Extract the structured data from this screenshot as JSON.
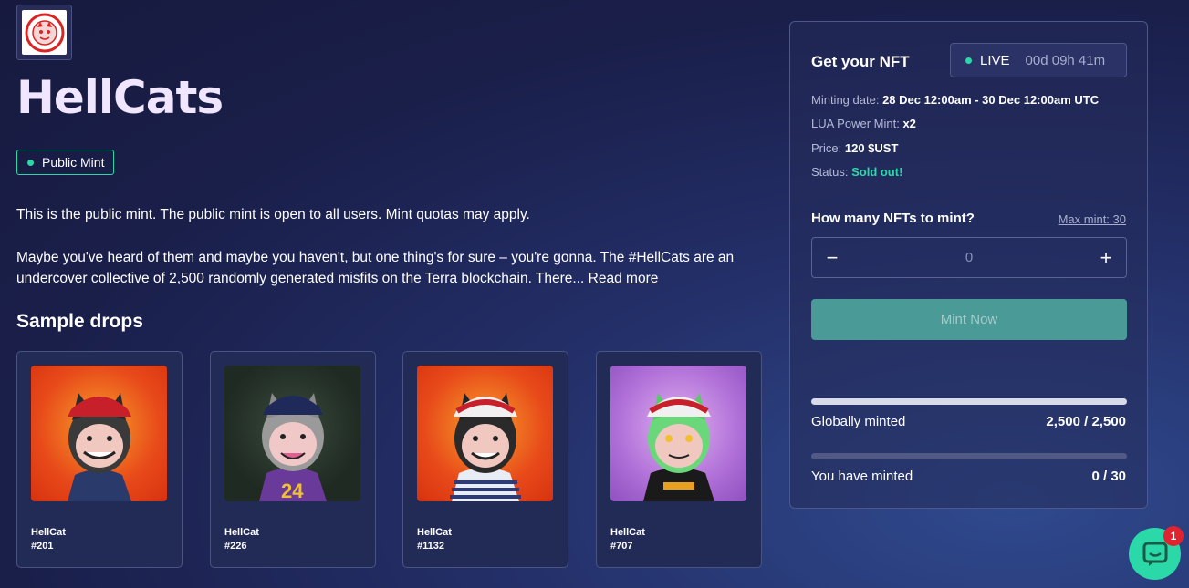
{
  "collection": {
    "logo_text_top": "HELL CATS",
    "logo_text_bottom": "HELL CATS",
    "title": "HellCats",
    "badge": "Public Mint",
    "description_1": "This is the public mint. The public mint is open to all users. Mint quotas may apply.",
    "description_2": "Maybe you've heard of them and maybe you haven't, but one thing's for sure – you're gonna. The #HellCats are an undercover collective of 2,500 randomly generated misfits on the Terra blockchain. There...",
    "read_more": "Read more"
  },
  "sample_drops": {
    "heading": "Sample drops",
    "items": [
      {
        "name": "HellCat",
        "id": "#201",
        "bg": "#e8401a"
      },
      {
        "name": "HellCat",
        "id": "#226",
        "bg": "#233025"
      },
      {
        "name": "HellCat",
        "id": "#1132",
        "bg": "#e84a1c"
      },
      {
        "name": "HellCat",
        "id": "#707",
        "bg": "#b87ad8"
      }
    ]
  },
  "mint_panel": {
    "title": "Get your NFT",
    "live_label": "LIVE",
    "countdown": "00d 09h 41m",
    "minting_date_label": "Minting date:",
    "minting_date": "28 Dec 12:00am - 30 Dec 12:00am UTC",
    "power_mint_label": "LUA Power Mint:",
    "power_mint": "x2",
    "price_label": "Price:",
    "price": "120 $UST",
    "status_label": "Status:",
    "status": "Sold out!",
    "quantity_label": "How many NFTs to mint?",
    "max_mint": "Max mint: 30",
    "minus": "−",
    "plus": "+",
    "quantity_value": "0",
    "mint_button": "Mint Now",
    "global_label": "Globally minted",
    "global_value": "2,500 / 2,500",
    "global_fraction": 1.0,
    "user_label": "You have minted",
    "user_value": "0 / 30",
    "user_fraction": 0.0
  },
  "chat": {
    "notification_count": "1"
  },
  "colors": {
    "accent": "#2bd9a8",
    "mint_button": "#4a9a98",
    "notification": "#e0232f"
  }
}
